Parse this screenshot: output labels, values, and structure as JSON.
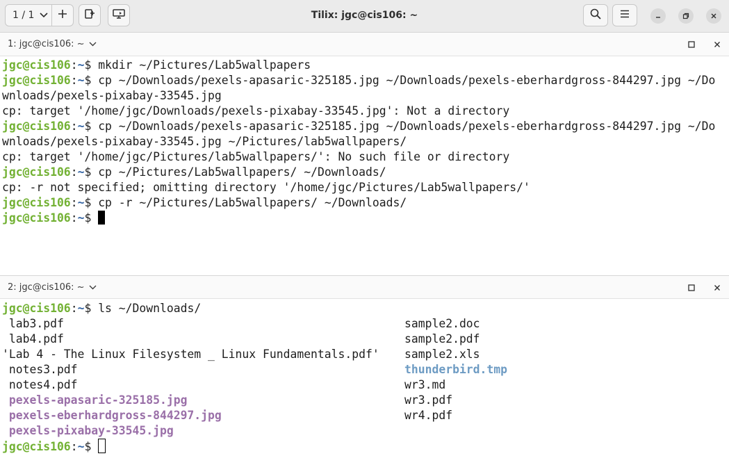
{
  "window": {
    "title": "Tilix: jgc@cis106: ~",
    "session_selector": "1 / 1"
  },
  "pane1": {
    "title": "1: jgc@cis106: ~",
    "lines": [
      {
        "kind": "prompt",
        "user": "jgc@cis106",
        "path": "~",
        "cmd": "mkdir ~/Pictures/Lab5wallpapers"
      },
      {
        "kind": "prompt",
        "user": "jgc@cis106",
        "path": "~",
        "cmd": "cp ~/Downloads/pexels-apasaric-325185.jpg ~/Downloads/pexels-eberhardgross-844297.jpg ~/Do"
      },
      {
        "kind": "out",
        "text": "wnloads/pexels-pixabay-33545.jpg"
      },
      {
        "kind": "out",
        "text": "cp: target '/home/jgc/Downloads/pexels-pixabay-33545.jpg': Not a directory"
      },
      {
        "kind": "prompt",
        "user": "jgc@cis106",
        "path": "~",
        "cmd": "cp ~/Downloads/pexels-apasaric-325185.jpg ~/Downloads/pexels-eberhardgross-844297.jpg ~/Do"
      },
      {
        "kind": "out",
        "text": "wnloads/pexels-pixabay-33545.jpg ~/Pictures/lab5wallpapers/"
      },
      {
        "kind": "out",
        "text": "cp: target '/home/jgc/Pictures/lab5wallpapers/': No such file or directory"
      },
      {
        "kind": "prompt",
        "user": "jgc@cis106",
        "path": "~",
        "cmd": "cp ~/Pictures/Lab5wallpapers/ ~/Downloads/"
      },
      {
        "kind": "out",
        "text": "cp: -r not specified; omitting directory '/home/jgc/Pictures/Lab5wallpapers/'"
      },
      {
        "kind": "prompt",
        "user": "jgc@cis106",
        "path": "~",
        "cmd": "cp -r ~/Pictures/Lab5wallpapers/ ~/Downloads/"
      },
      {
        "kind": "prompt",
        "user": "jgc@cis106",
        "path": "~",
        "cmd": ""
      }
    ]
  },
  "pane2": {
    "title": "2: jgc@cis106: ~",
    "command": {
      "user": "jgc@cis106",
      "path": "~",
      "cmd": "ls ~/Downloads/"
    },
    "listing_col1": [
      {
        "name": " lab3.pdf",
        "type": "file"
      },
      {
        "name": " lab4.pdf",
        "type": "file"
      },
      {
        "name": "'Lab 4 - The Linux Filesystem _ Linux Fundamentals.pdf'",
        "type": "file"
      },
      {
        "name": " notes3.pdf",
        "type": "file"
      },
      {
        "name": " notes4.pdf",
        "type": "file"
      },
      {
        "name": " pexels-apasaric-325185.jpg",
        "type": "image"
      },
      {
        "name": " pexels-eberhardgross-844297.jpg",
        "type": "image"
      },
      {
        "name": " pexels-pixabay-33545.jpg",
        "type": "image"
      }
    ],
    "listing_col2": [
      {
        "name": "sample2.doc",
        "type": "file"
      },
      {
        "name": "sample2.pdf",
        "type": "file"
      },
      {
        "name": "sample2.xls",
        "type": "file"
      },
      {
        "name": "thunderbird.tmp",
        "type": "dir"
      },
      {
        "name": "wr3.md",
        "type": "file"
      },
      {
        "name": "wr3.pdf",
        "type": "file"
      },
      {
        "name": "wr4.pdf",
        "type": "file"
      }
    ],
    "final_prompt": {
      "user": "jgc@cis106",
      "path": "~"
    }
  },
  "colors": {
    "prompt_user": "#72b133",
    "prompt_path": "#3465a4",
    "image_file": "#9a6fa8",
    "directory": "#6d9bc3"
  }
}
